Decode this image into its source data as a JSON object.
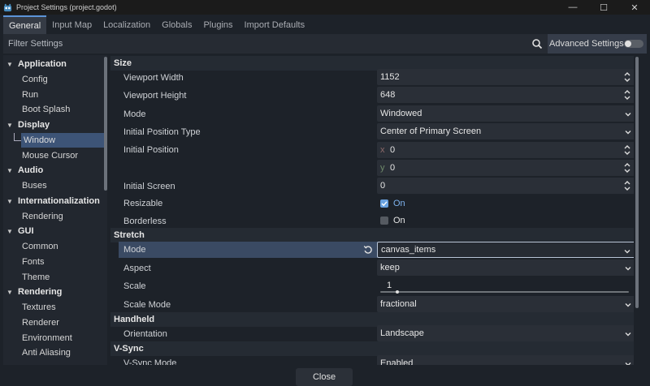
{
  "window": {
    "title": "Project Settings (project.godot)",
    "controls": [
      "—",
      "☐",
      "✕"
    ]
  },
  "tabs": [
    "General",
    "Input Map",
    "Localization",
    "Globals",
    "Plugins",
    "Import Defaults"
  ],
  "filter": {
    "placeholder": "Filter Settings",
    "advanced_label": "Advanced Settings",
    "advanced_enabled": false
  },
  "sidebar": [
    {
      "label": "Application",
      "type": "category"
    },
    {
      "label": "Config",
      "type": "child"
    },
    {
      "label": "Run",
      "type": "child"
    },
    {
      "label": "Boot Splash",
      "type": "child"
    },
    {
      "label": "Display",
      "type": "category"
    },
    {
      "label": "Window",
      "type": "child",
      "selected": true
    },
    {
      "label": "Mouse Cursor",
      "type": "child"
    },
    {
      "label": "Audio",
      "type": "category"
    },
    {
      "label": "Buses",
      "type": "child"
    },
    {
      "label": "Internationalization",
      "type": "category"
    },
    {
      "label": "Rendering",
      "type": "child"
    },
    {
      "label": "GUI",
      "type": "category"
    },
    {
      "label": "Common",
      "type": "child"
    },
    {
      "label": "Fonts",
      "type": "child"
    },
    {
      "label": "Theme",
      "type": "child"
    },
    {
      "label": "Rendering",
      "type": "category"
    },
    {
      "label": "Textures",
      "type": "child"
    },
    {
      "label": "Renderer",
      "type": "child"
    },
    {
      "label": "Environment",
      "type": "child"
    },
    {
      "label": "Anti Aliasing",
      "type": "child"
    }
  ],
  "inspector": {
    "size_section": "Size",
    "viewport_width": {
      "label": "Viewport Width",
      "value": "1152"
    },
    "viewport_height": {
      "label": "Viewport Height",
      "value": "648"
    },
    "mode": {
      "label": "Mode",
      "value": "Windowed"
    },
    "initial_position_type": {
      "label": "Initial Position Type",
      "value": "Center of Primary Screen"
    },
    "initial_position": {
      "label": "Initial Position",
      "x_axis": "x",
      "x": "0",
      "y_axis": "y",
      "y": "0"
    },
    "initial_screen": {
      "label": "Initial Screen",
      "value": "0"
    },
    "resizable": {
      "label": "Resizable",
      "value": "On",
      "checked": true
    },
    "borderless": {
      "label": "Borderless",
      "value": "On",
      "checked": false
    },
    "stretch_section": "Stretch",
    "stretch_mode": {
      "label": "Mode",
      "value": "canvas_items"
    },
    "aspect": {
      "label": "Aspect",
      "value": "keep"
    },
    "scale": {
      "label": "Scale",
      "value": "1"
    },
    "scale_mode": {
      "label": "Scale Mode",
      "value": "fractional"
    },
    "handheld_section": "Handheld",
    "orientation": {
      "label": "Orientation",
      "value": "Landscape"
    },
    "vsync_section": "V-Sync",
    "vsync_mode": {
      "label": "V-Sync Mode",
      "value": "Enabled"
    }
  },
  "footer": {
    "close_label": "Close"
  },
  "colors": {
    "accent": "#5c93d6",
    "selection": "#3d5477",
    "check_on": "#6aa2e0"
  }
}
